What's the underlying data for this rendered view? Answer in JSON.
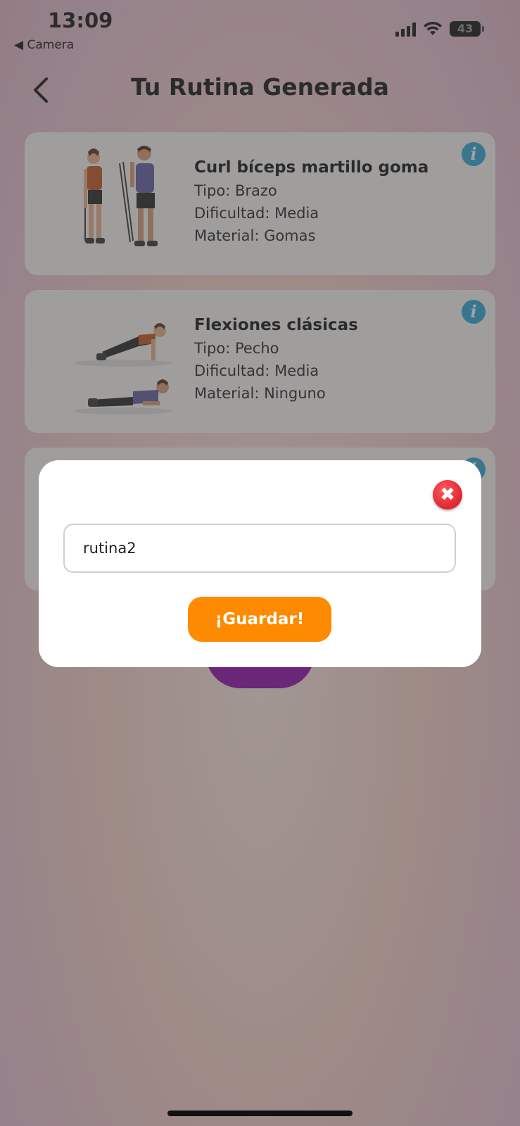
{
  "status_bar": {
    "time": "13:09",
    "back_app": "◀ Camera",
    "battery": "43"
  },
  "header": {
    "title": "Tu Rutina Generada"
  },
  "exercises": [
    {
      "name": "Curl bíceps martillo goma",
      "tipo": "Tipo: Brazo",
      "dificultad": "Dificultad: Media",
      "material": "Material: Gomas"
    },
    {
      "name": "Flexiones clásicas",
      "tipo": "Tipo: Pecho",
      "dificultad": "Dificultad: Media",
      "material": "Material: Ninguno"
    }
  ],
  "modal": {
    "input_value": "rutina2",
    "save_label": "¡Guardar!",
    "close_symbol": "✖"
  },
  "info_symbol": "i",
  "colors": {
    "accent_orange": "#fe8a00",
    "close_red": "#e0182a",
    "info_blue": "#2aa7d6",
    "purple_button": "#8f06a8"
  }
}
